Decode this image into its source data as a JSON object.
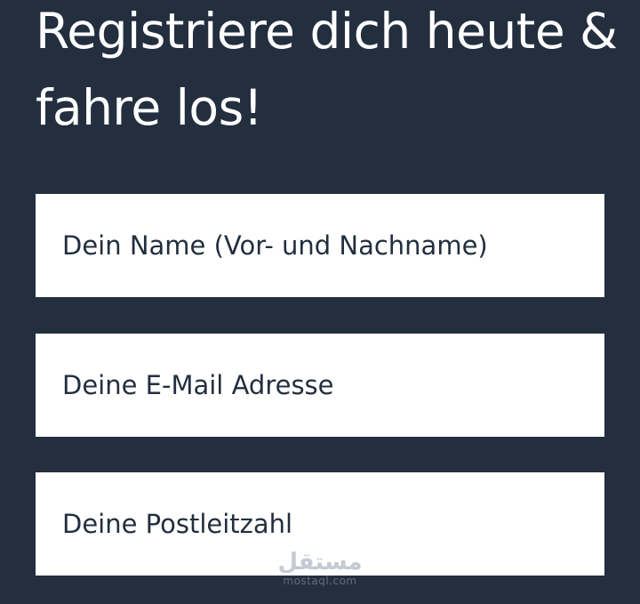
{
  "form": {
    "headline_line1": "Registriere dich heute &",
    "headline_line2": "fahre los!",
    "name_placeholder": "Dein Name (Vor- und Nachname)",
    "email_placeholder": "Deine E-Mail Adresse",
    "zip_placeholder": "Deine Postleitzahl"
  },
  "watermark": {
    "arabic": "مستقل",
    "latin": "mostaql.com"
  },
  "colors": {
    "background": "#232f3f",
    "field_background": "#ffffff",
    "headline_text": "#ffffff",
    "field_text": "#232f3f"
  }
}
